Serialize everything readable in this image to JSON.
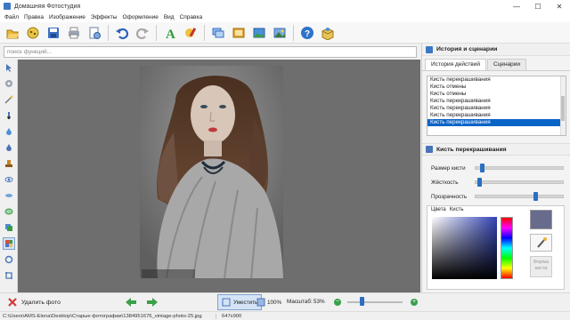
{
  "window": {
    "title": "Домашняя Фотостудия",
    "minimize": "—",
    "maximize": "☐",
    "close": "✕"
  },
  "menu": [
    "Файл",
    "Правка",
    "Изображение",
    "Эффекты",
    "Оформление",
    "Вид",
    "Справка"
  ],
  "toolbar": {
    "icons": [
      "open-icon",
      "effects-icon",
      "save-icon",
      "print-icon",
      "export-icon",
      "undo-icon",
      "redo-icon",
      "text-icon",
      "paint-icon",
      "image-icon",
      "frame-icon",
      "picture-icon",
      "landscape-icon",
      "help-icon",
      "box-icon"
    ]
  },
  "search": {
    "placeholder": "поиск функций..."
  },
  "right_panel": {
    "history_title": "История и сценарии",
    "tabs": [
      "История действий",
      "Сценарии"
    ],
    "history": [
      "Кисть перекрашивания",
      "Кисть отмены",
      "Кисть отмены",
      "Кисть перекрашивания",
      "Кисть перекрашивания",
      "Кисть перекрашивания",
      "Кисть перекрашивания"
    ],
    "selected_index": 6,
    "brush_title": "Кисть перекрашивания",
    "sliders": [
      {
        "label": "Размер кисти",
        "value": 0.05
      },
      {
        "label": "Жёсткость",
        "value": 0.02
      },
      {
        "label": "Прозрачность",
        "value": 0.68
      }
    ],
    "color_tabs": [
      "Цвета",
      "Кисть"
    ],
    "current_color": "#676b8c",
    "form_button": "Форма кисти"
  },
  "bottom": {
    "delete_label": "Удалить фото",
    "fit_label": "Уместить",
    "zoom100_label": "100%",
    "scale_label": "Масштаб:",
    "scale_value": "53%",
    "zoom_slider": 0.25
  },
  "status": {
    "path": "C:\\Users\\AMS-Elena\\Desktop\\Старые фотографии\\1384951676_vintage-photo-25.jpg",
    "size": "647x900"
  },
  "colors": {
    "accent": "#0a64c8",
    "canvas": "#6e6e6e",
    "selection": "#0a64c8"
  }
}
